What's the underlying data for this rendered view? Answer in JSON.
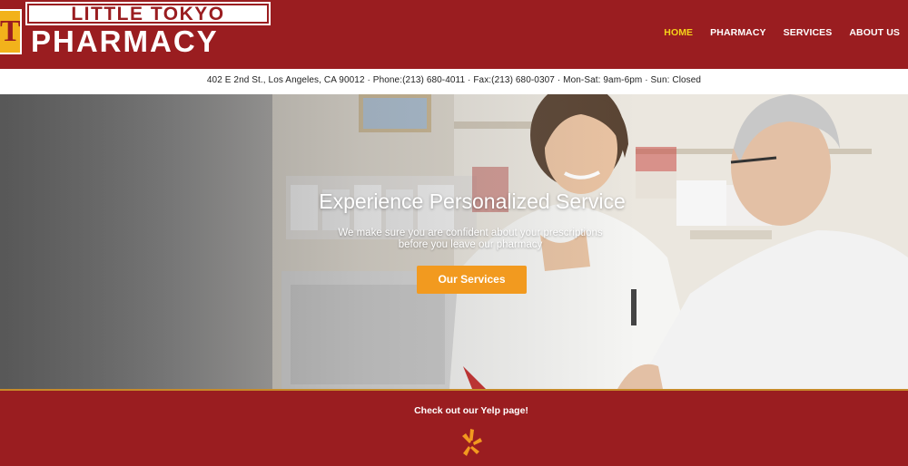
{
  "logo": {
    "mark": "T",
    "line1": "LITTLE TOKYO",
    "line2": "PHARMACY"
  },
  "nav": {
    "items": [
      {
        "label": "HOME",
        "active": true
      },
      {
        "label": "PHARMACY",
        "active": false
      },
      {
        "label": "SERVICES",
        "active": false
      },
      {
        "label": "ABOUT US",
        "active": false
      }
    ]
  },
  "info_bar": {
    "text": "402 E 2nd St., Los Angeles, CA 90012 · Phone:(213) 680-4011 · Fax:(213) 680-0307 · Mon-Sat: 9am-6pm · Sun: Closed"
  },
  "hero": {
    "title": "Experience Personalized Service",
    "subtitle_line1": "We make sure you are confident about your prescriptions",
    "subtitle_line2": "before you leave our pharmacy",
    "button_label": "Our Services"
  },
  "footer": {
    "yelp_text": "Check out our Yelp page!",
    "yelp_icon": "yelp-icon"
  },
  "colors": {
    "brand_red": "#9a1d20",
    "accent_yellow": "#f5d11a",
    "button_orange": "#f29a1f",
    "logo_gold": "#f2b21b"
  }
}
